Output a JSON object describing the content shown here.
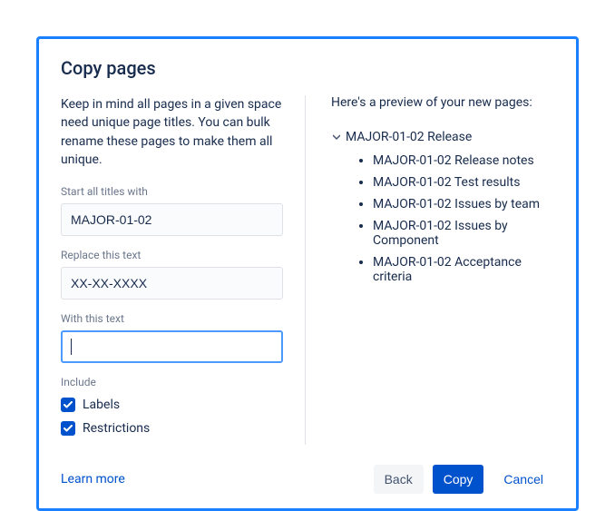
{
  "dialog": {
    "title": "Copy pages",
    "description": "Keep in mind all pages in a given space need unique page titles. You can bulk rename these pages to make them all unique."
  },
  "fields": {
    "prefix": {
      "label": "Start all titles with",
      "value": "MAJOR-01-02"
    },
    "replace_this": {
      "label": "Replace this text",
      "value": "XX-XX-XXXX"
    },
    "with_this": {
      "label": "With this text",
      "value": ""
    }
  },
  "include": {
    "label": "Include",
    "labels": {
      "text": "Labels",
      "checked": true
    },
    "restrictions": {
      "text": "Restrictions",
      "checked": true
    }
  },
  "preview": {
    "title": "Here's a preview of your new pages:",
    "root": "MAJOR-01-02 Release",
    "children": [
      "MAJOR-01-02 Release notes",
      "MAJOR-01-02 Test results",
      "MAJOR-01-02 Issues by team",
      "MAJOR-01-02 Issues by Component",
      "MAJOR-01-02 Acceptance criteria"
    ]
  },
  "footer": {
    "learn_more": "Learn more",
    "back": "Back",
    "copy": "Copy",
    "cancel": "Cancel"
  },
  "colors": {
    "primary": "#0052cc",
    "focus": "#4c9aff",
    "border_highlight": "#1a80ff"
  }
}
